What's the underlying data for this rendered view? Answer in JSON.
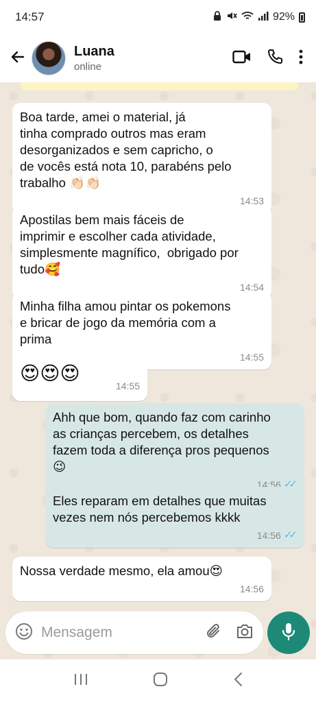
{
  "status_bar": {
    "time": "14:57",
    "battery": "92%"
  },
  "header": {
    "contact_name": "Luana",
    "contact_status": "online"
  },
  "messages": [
    {
      "direction": "in",
      "text": "Boa tarde, amei o material, já\ntinha comprado outros mas eram\ndesorganizados e sem capricho, o\nde vocês está nota 10, parabéns pelo\ntrabalho 👏🏻👏🏻",
      "time": "14:53"
    },
    {
      "direction": "in",
      "text": "Apostilas bem mais fáceis de\nimprimir e escolher cada atividade,\nsimplesmente magnífico,  obrigado por\ntudo🥰",
      "time": "14:54"
    },
    {
      "direction": "in",
      "text": "Minha filha amou pintar os pokemons\ne bricar de jogo da memória com a\nprima",
      "time": "14:55"
    },
    {
      "direction": "in",
      "text": "😍😍😍",
      "time": "14:55"
    },
    {
      "direction": "out",
      "text": "Ahh que bom, quando faz com carinho\nas crianças percebem, os detalhes\nfazem toda a diferença pros pequenos\n😉",
      "time": "14:56",
      "ticks": "✓✓"
    },
    {
      "direction": "out",
      "text": "Eles reparam em detalhes que muitas\nvezes nem nós percebemos kkkk",
      "time": "14:56",
      "ticks": "✓✓"
    },
    {
      "direction": "in",
      "text": "Nossa verdade mesmo, ela amou😍",
      "time": "14:56"
    }
  ],
  "input": {
    "placeholder": "Mensagem"
  },
  "icons": {
    "back": "arrow-left-icon",
    "video": "video-call-icon",
    "phone": "phone-icon",
    "menu": "more-vert-icon",
    "emoji": "emoji-icon",
    "attach": "paperclip-icon",
    "camera": "camera-icon",
    "mic": "mic-icon"
  },
  "colors": {
    "accent": "#1d8a78",
    "outgoing_bubble": "#d7e7e6",
    "incoming_bubble": "#ffffff",
    "read_ticks": "#53bdeb"
  }
}
